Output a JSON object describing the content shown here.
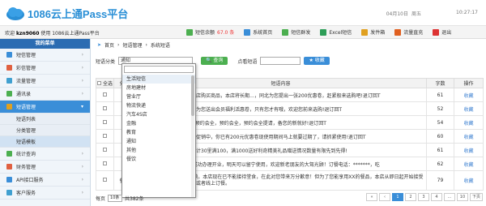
{
  "header": {
    "brand": "1086云上通Pass平台",
    "date": "04月10日",
    "weekday": "周五",
    "time": "10:27:17"
  },
  "subbar": {
    "welcome_prefix": "欢迎",
    "user": "kzn9060",
    "welcome_suffix": "使用 1086云上通Pass平台",
    "tools": [
      {
        "label": "短信余额",
        "count": "67.0 条",
        "icon": "sms-balance-icon",
        "color": "#4caf50"
      },
      {
        "label": "系统首页",
        "icon": "home-icon",
        "color": "#3a8ed8"
      },
      {
        "label": "短信群发",
        "icon": "broadcast-icon",
        "color": "#4caf50"
      },
      {
        "label": "Excel短信",
        "icon": "excel-icon",
        "color": "#2e9e58"
      },
      {
        "label": "发件箱",
        "icon": "outbox-icon",
        "color": "#e0a020"
      },
      {
        "label": "流量直充",
        "icon": "traffic-icon",
        "color": "#e06020"
      },
      {
        "label": "退出",
        "icon": "exit-icon",
        "color": "#d33"
      }
    ]
  },
  "sidebar": {
    "title": "我的菜单",
    "items": [
      {
        "label": "短信管理",
        "color": "#3a8ed8"
      },
      {
        "label": "彩信管理",
        "color": "#e06040"
      },
      {
        "label": "流量管理",
        "color": "#40a0d0"
      },
      {
        "label": "通讯录",
        "color": "#4caf50"
      },
      {
        "label": "短语管理",
        "color": "#e0a020",
        "active": true
      }
    ],
    "subitems": [
      "短语列表",
      "分类管理",
      "短语模板"
    ],
    "items2": [
      {
        "label": "统计查询",
        "color": "#4caf50"
      },
      {
        "label": "财务管理",
        "color": "#e06040"
      },
      {
        "label": "API接口服务",
        "color": "#3a8ed8"
      },
      {
        "label": "客户服务",
        "color": "#40a0d0"
      }
    ]
  },
  "breadcrumb": {
    "home": "首页",
    "sep": "›",
    "l2": "短语管理",
    "l3": "系统短语"
  },
  "filter": {
    "category_label": "短语分类",
    "category_value": "通知",
    "query_btn": "查询",
    "keyword_label": "点看短语",
    "keyword_value": "",
    "fav_btn": "收藏"
  },
  "dropdown": {
    "items": [
      "生活短信",
      "房地建材",
      "营业厅",
      "物流快递",
      "汽车4S店",
      "金融",
      "教育",
      "通知",
      "其他",
      "餐饮"
    ]
  },
  "table": {
    "headers": [
      "全选",
      "分类",
      "短语内容",
      "字数",
      "操作"
    ],
    "rows": [
      {
        "cat": "",
        "content": "客户，您常想要彩您音在本店购买商品，本店将长期…，同北为您提出一张200优惠卷，赶紧般来选购吧!退订回T",
        "count": "61",
        "op": "收藏"
      },
      {
        "cat": "",
        "content": "用户，春天到了，本店特意为您送出会员福利活惠卷，只有您才有哦，欢迎您前来选购!退订回T",
        "count": "52",
        "op": "收藏"
      },
      {
        "cat": "",
        "content": "X下sx不优惠活动将会实，预约会全，预约会全，预约会全提请，备您的新就好!退订回T",
        "count": "54",
        "op": "收藏"
      },
      {
        "cat": "",
        "content": "本店正在进行春季大型活动促销中，你已有200元优惠卷现使用期间马上就要过期了，请抓紧使用!退订回T",
        "count": "60",
        "op": "收藏"
      },
      {
        "cat": "",
        "content": "用户，春季新品上线啦，预计30里满100，满1000送好利奇精美礼品赠送情况数量有限先到先得!",
        "count": "61",
        "op": "收藏"
      },
      {
        "cat": "",
        "content": "新霸家餐饮您惠+\"，已经成功办理开业，明天可以留宁使用，欢迎新老朋友的大驾光顾！订餐电话：*******，吃",
        "count": "62",
        "op": "收藏"
      },
      {
        "cat": "餐饮",
        "content": "【XX餐厅】由于安全理影响，本店现在已不能接待堂食，在此对您带来万分歉意！但为了您能享用XX的餐品，本店从即日起开始接受预订一天预定（到店自取）或者线上订餐。",
        "count": "79",
        "op": "收藏"
      }
    ]
  },
  "pager": {
    "per_page_label": "每页",
    "per_page": "10条",
    "total": "共382条",
    "pages": [
      "«",
      "‹",
      "1",
      "2",
      "3",
      "4",
      "...",
      "10",
      "下页"
    ]
  }
}
